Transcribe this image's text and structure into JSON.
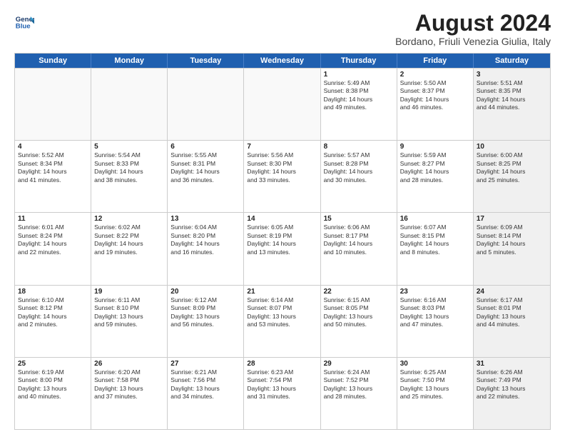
{
  "header": {
    "logo_line1": "General",
    "logo_line2": "Blue",
    "month_title": "August 2024",
    "subtitle": "Bordano, Friuli Venezia Giulia, Italy"
  },
  "weekdays": [
    "Sunday",
    "Monday",
    "Tuesday",
    "Wednesday",
    "Thursday",
    "Friday",
    "Saturday"
  ],
  "rows": [
    [
      {
        "day": "",
        "info": "",
        "shaded": false,
        "empty": true
      },
      {
        "day": "",
        "info": "",
        "shaded": false,
        "empty": true
      },
      {
        "day": "",
        "info": "",
        "shaded": false,
        "empty": true
      },
      {
        "day": "",
        "info": "",
        "shaded": false,
        "empty": true
      },
      {
        "day": "1",
        "info": "Sunrise: 5:49 AM\nSunset: 8:38 PM\nDaylight: 14 hours\nand 49 minutes.",
        "shaded": false,
        "empty": false
      },
      {
        "day": "2",
        "info": "Sunrise: 5:50 AM\nSunset: 8:37 PM\nDaylight: 14 hours\nand 46 minutes.",
        "shaded": false,
        "empty": false
      },
      {
        "day": "3",
        "info": "Sunrise: 5:51 AM\nSunset: 8:35 PM\nDaylight: 14 hours\nand 44 minutes.",
        "shaded": true,
        "empty": false
      }
    ],
    [
      {
        "day": "4",
        "info": "Sunrise: 5:52 AM\nSunset: 8:34 PM\nDaylight: 14 hours\nand 41 minutes.",
        "shaded": false,
        "empty": false
      },
      {
        "day": "5",
        "info": "Sunrise: 5:54 AM\nSunset: 8:33 PM\nDaylight: 14 hours\nand 38 minutes.",
        "shaded": false,
        "empty": false
      },
      {
        "day": "6",
        "info": "Sunrise: 5:55 AM\nSunset: 8:31 PM\nDaylight: 14 hours\nand 36 minutes.",
        "shaded": false,
        "empty": false
      },
      {
        "day": "7",
        "info": "Sunrise: 5:56 AM\nSunset: 8:30 PM\nDaylight: 14 hours\nand 33 minutes.",
        "shaded": false,
        "empty": false
      },
      {
        "day": "8",
        "info": "Sunrise: 5:57 AM\nSunset: 8:28 PM\nDaylight: 14 hours\nand 30 minutes.",
        "shaded": false,
        "empty": false
      },
      {
        "day": "9",
        "info": "Sunrise: 5:59 AM\nSunset: 8:27 PM\nDaylight: 14 hours\nand 28 minutes.",
        "shaded": false,
        "empty": false
      },
      {
        "day": "10",
        "info": "Sunrise: 6:00 AM\nSunset: 8:25 PM\nDaylight: 14 hours\nand 25 minutes.",
        "shaded": true,
        "empty": false
      }
    ],
    [
      {
        "day": "11",
        "info": "Sunrise: 6:01 AM\nSunset: 8:24 PM\nDaylight: 14 hours\nand 22 minutes.",
        "shaded": false,
        "empty": false
      },
      {
        "day": "12",
        "info": "Sunrise: 6:02 AM\nSunset: 8:22 PM\nDaylight: 14 hours\nand 19 minutes.",
        "shaded": false,
        "empty": false
      },
      {
        "day": "13",
        "info": "Sunrise: 6:04 AM\nSunset: 8:20 PM\nDaylight: 14 hours\nand 16 minutes.",
        "shaded": false,
        "empty": false
      },
      {
        "day": "14",
        "info": "Sunrise: 6:05 AM\nSunset: 8:19 PM\nDaylight: 14 hours\nand 13 minutes.",
        "shaded": false,
        "empty": false
      },
      {
        "day": "15",
        "info": "Sunrise: 6:06 AM\nSunset: 8:17 PM\nDaylight: 14 hours\nand 10 minutes.",
        "shaded": false,
        "empty": false
      },
      {
        "day": "16",
        "info": "Sunrise: 6:07 AM\nSunset: 8:15 PM\nDaylight: 14 hours\nand 8 minutes.",
        "shaded": false,
        "empty": false
      },
      {
        "day": "17",
        "info": "Sunrise: 6:09 AM\nSunset: 8:14 PM\nDaylight: 14 hours\nand 5 minutes.",
        "shaded": true,
        "empty": false
      }
    ],
    [
      {
        "day": "18",
        "info": "Sunrise: 6:10 AM\nSunset: 8:12 PM\nDaylight: 14 hours\nand 2 minutes.",
        "shaded": false,
        "empty": false
      },
      {
        "day": "19",
        "info": "Sunrise: 6:11 AM\nSunset: 8:10 PM\nDaylight: 13 hours\nand 59 minutes.",
        "shaded": false,
        "empty": false
      },
      {
        "day": "20",
        "info": "Sunrise: 6:12 AM\nSunset: 8:09 PM\nDaylight: 13 hours\nand 56 minutes.",
        "shaded": false,
        "empty": false
      },
      {
        "day": "21",
        "info": "Sunrise: 6:14 AM\nSunset: 8:07 PM\nDaylight: 13 hours\nand 53 minutes.",
        "shaded": false,
        "empty": false
      },
      {
        "day": "22",
        "info": "Sunrise: 6:15 AM\nSunset: 8:05 PM\nDaylight: 13 hours\nand 50 minutes.",
        "shaded": false,
        "empty": false
      },
      {
        "day": "23",
        "info": "Sunrise: 6:16 AM\nSunset: 8:03 PM\nDaylight: 13 hours\nand 47 minutes.",
        "shaded": false,
        "empty": false
      },
      {
        "day": "24",
        "info": "Sunrise: 6:17 AM\nSunset: 8:01 PM\nDaylight: 13 hours\nand 44 minutes.",
        "shaded": true,
        "empty": false
      }
    ],
    [
      {
        "day": "25",
        "info": "Sunrise: 6:19 AM\nSunset: 8:00 PM\nDaylight: 13 hours\nand 40 minutes.",
        "shaded": false,
        "empty": false
      },
      {
        "day": "26",
        "info": "Sunrise: 6:20 AM\nSunset: 7:58 PM\nDaylight: 13 hours\nand 37 minutes.",
        "shaded": false,
        "empty": false
      },
      {
        "day": "27",
        "info": "Sunrise: 6:21 AM\nSunset: 7:56 PM\nDaylight: 13 hours\nand 34 minutes.",
        "shaded": false,
        "empty": false
      },
      {
        "day": "28",
        "info": "Sunrise: 6:23 AM\nSunset: 7:54 PM\nDaylight: 13 hours\nand 31 minutes.",
        "shaded": false,
        "empty": false
      },
      {
        "day": "29",
        "info": "Sunrise: 6:24 AM\nSunset: 7:52 PM\nDaylight: 13 hours\nand 28 minutes.",
        "shaded": false,
        "empty": false
      },
      {
        "day": "30",
        "info": "Sunrise: 6:25 AM\nSunset: 7:50 PM\nDaylight: 13 hours\nand 25 minutes.",
        "shaded": false,
        "empty": false
      },
      {
        "day": "31",
        "info": "Sunrise: 6:26 AM\nSunset: 7:49 PM\nDaylight: 13 hours\nand 22 minutes.",
        "shaded": true,
        "empty": false
      }
    ]
  ]
}
